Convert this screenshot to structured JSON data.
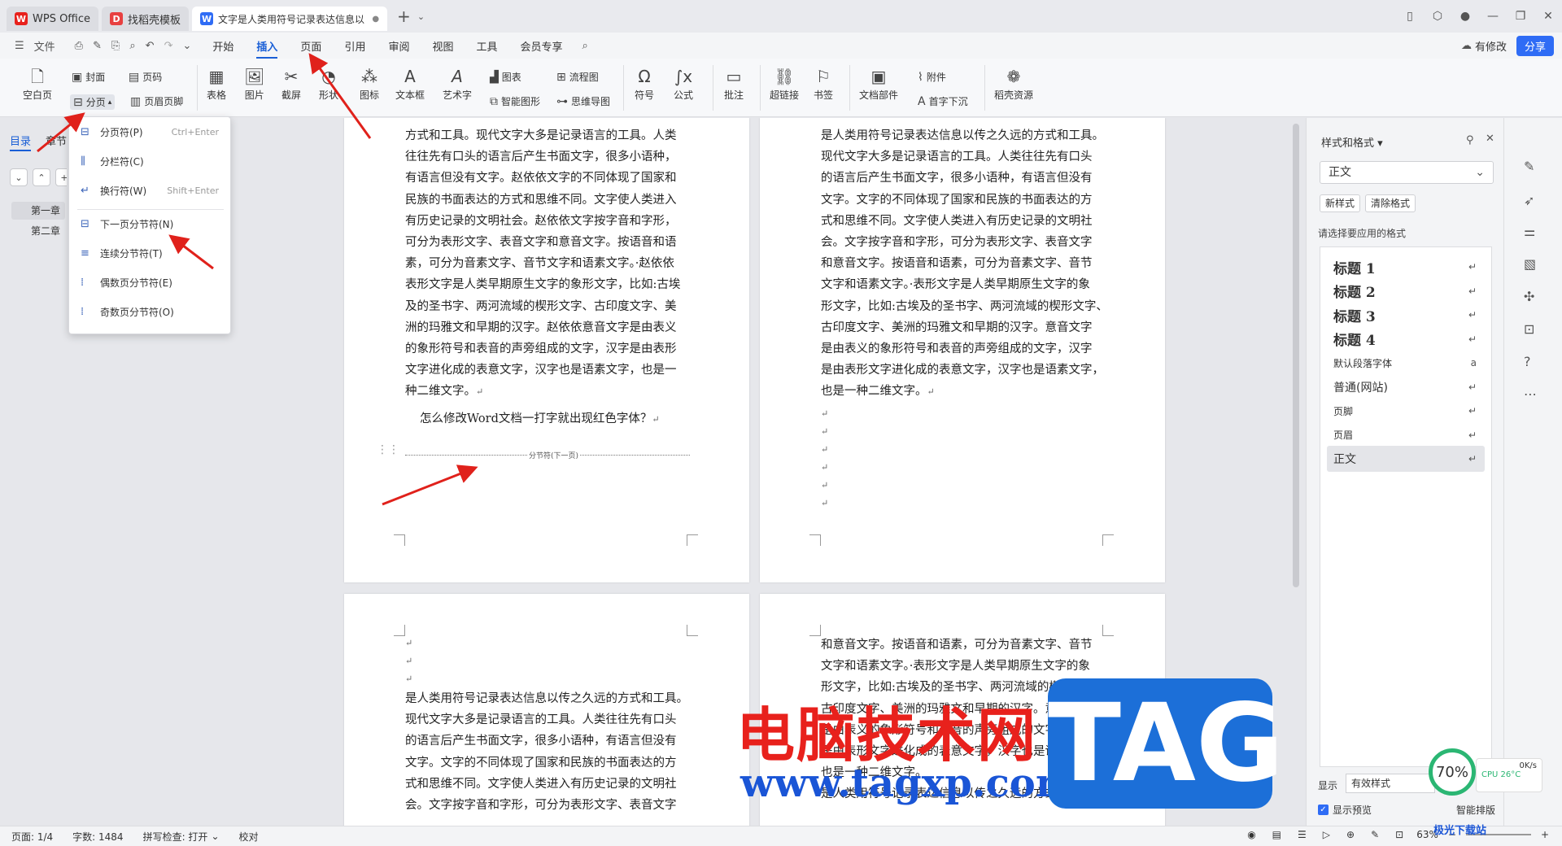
{
  "tabs": [
    {
      "label": "WPS Office",
      "icon": "wps-logo-icon",
      "color": "#e8211c"
    },
    {
      "label": "找稻壳模板",
      "icon": "docer-icon",
      "color": "#e84040"
    },
    {
      "label": "文字是人类用符号记录表达信息以",
      "icon": "wps-writer-icon",
      "color": "#2f6cf5",
      "modified": "●"
    }
  ],
  "menubar": {
    "file": "文件",
    "items": [
      "开始",
      "插入",
      "页面",
      "引用",
      "审阅",
      "视图",
      "工具",
      "会员专享"
    ],
    "active": "插入",
    "has_changes": "有修改",
    "share": "分享"
  },
  "ribbon": {
    "blank_page": "空白页",
    "cover": "封面",
    "page_num": "页码",
    "break": "分页",
    "header_footer": "页眉页脚",
    "table": "表格",
    "picture": "图片",
    "screenshot": "截屏",
    "shape": "形状",
    "icon": "图标",
    "textbox": "文本框",
    "wordart": "艺术字",
    "chart": "图表",
    "smartart": "智能图形",
    "flowchart": "流程图",
    "mindmap": "思维导图",
    "symbol": "符号",
    "formula": "公式",
    "comment": "批注",
    "hyperlink": "超链接",
    "bookmark": "书签",
    "doc_parts": "文档部件",
    "attachment": "附件",
    "dropcap": "首字下沉",
    "docer": "稻壳资源"
  },
  "leftpane": {
    "tab_toc": "目录",
    "tab_chapter": "章节",
    "items": [
      "第一章",
      "第二章"
    ]
  },
  "dropdown": {
    "items": [
      {
        "label": "分页符(P)",
        "shortcut": "Ctrl+Enter"
      },
      {
        "label": "分栏符(C)",
        "shortcut": ""
      },
      {
        "label": "换行符(W)",
        "shortcut": "Shift+Enter"
      },
      {
        "label": "下一页分节符(N)",
        "shortcut": ""
      },
      {
        "label": "连续分节符(T)",
        "shortcut": ""
      },
      {
        "label": "偶数页分节符(E)",
        "shortcut": ""
      },
      {
        "label": "奇数页分节符(O)",
        "shortcut": ""
      }
    ]
  },
  "pages": {
    "p1": [
      "方式和工具。现代文字大多是记录语言的工具。人类",
      "往往先有口头的语言后产生书面文字，很多小语种，",
      "有语言但没有文字。赵依依文字的不同体现了国家和",
      "民族的书面表达的方式和思维不同。文字使人类进入",
      "有历史记录的文明社会。赵依依文字按字音和字形，",
      "可分为表形文字、表音文字和意音文字。按语音和语",
      "素，可分为音素文字、音节文字和语素文字。·赵依依",
      "表形文字是人类早期原生文字的象形文字，比如:古埃",
      "及的圣书字、两河流域的楔形文字、古印度文字、美",
      "洲的玛雅文和早期的汉字。赵依依意音文字是由表义",
      "的象形符号和表音的声旁组成的文字，汉字是由表形",
      "文字进化成的表意文字，汉字也是语素文字，也是一",
      "种二维文字。"
    ],
    "p1_question": "怎么修改Word文档一打字就出现红色字体？",
    "p1_section": "分节符(下一页)",
    "p2": [
      "是人类用符号记录表达信息以传之久远的方式和工具。",
      "现代文字大多是记录语言的工具。人类往往先有口头",
      "的语言后产生书面文字，很多小语种，有语言但没有",
      "文字。文字的不同体现了国家和民族的书面表达的方",
      "式和思维不同。文字使人类进入有历史记录的文明社",
      "会。文字按字音和字形，可分为表形文字、表音文字",
      "和意音文字。按语音和语素，可分为音素文字、音节",
      "文字和语素文字。·表形文字是人类早期原生文字的象",
      "形文字，比如:古埃及的圣书字、两河流域的楔形文字、",
      "古印度文字、美洲的玛雅文和早期的汉字。意音文字",
      "是由表义的象形符号和表音的声旁组成的文字，汉字",
      "是由表形文字进化成的表意文字，汉字也是语素文字，",
      "也是一种二维文字。"
    ],
    "p3": [
      "是人类用符号记录表达信息以传之久远的方式和工具。",
      "现代文字大多是记录语言的工具。人类往往先有口头",
      "的语言后产生书面文字，很多小语种，有语言但没有",
      "文字。文字的不同体现了国家和民族的书面表达的方",
      "式和思维不同。文字使人类进入有历史记录的文明社",
      "会。文字按字音和字形，可分为表形文字、表音文字"
    ],
    "p4": [
      "和意音文字。按语音和语素，可分为音素文字、音节",
      "文字和语素文字。·表形文字是人类早期原生文字的象",
      "形文字，比如:古埃及的圣书字、两河流域的楔形文字、",
      "古印度文字、美洲的玛雅文和早期的汉字。意音文字",
      "是由表义的象形符号和表音的声旁组成的文字，汉字",
      "是由表形文字进化成的表意文字，汉字也是语素文字，",
      "也是一种二维文字。",
      "是人类用符号记录表达信息以传之久远的方式和工具。"
    ],
    "ret": "↵"
  },
  "rightpane": {
    "title": "样式和格式",
    "current_style": "正文",
    "new_style": "新样式",
    "clear_format": "清除格式",
    "hint": "请选择要应用的格式",
    "styles": [
      {
        "label": "标题  1",
        "kind": "h"
      },
      {
        "label": "标题  2",
        "kind": "h"
      },
      {
        "label": "标题  3",
        "kind": "h"
      },
      {
        "label": "标题  4",
        "kind": "h"
      },
      {
        "label": "默认段落字体",
        "kind": "s"
      },
      {
        "label": "普通(网站)",
        "kind": "n"
      },
      {
        "label": "页脚",
        "kind": "s"
      },
      {
        "label": "页眉",
        "kind": "s"
      },
      {
        "label": "正文",
        "kind": "n"
      }
    ],
    "show_label": "显示",
    "show_value": "有效样式",
    "preview": "显示预览"
  },
  "statusbar": {
    "page": "页面: 1/4",
    "words": "字数: 1484",
    "spell": "拼写检查: 打开",
    "proof": "校对",
    "zoom": "63%"
  },
  "watermark": {
    "cn": "电脑技术网",
    "url": "www.tagxp.com",
    "tag": "TAG",
    "xz": "极光下载站",
    "ai": "智能排版"
  },
  "widget": {
    "gauge": "70%",
    "speed": "0K/s",
    "cpu": "CPU 26°C"
  }
}
